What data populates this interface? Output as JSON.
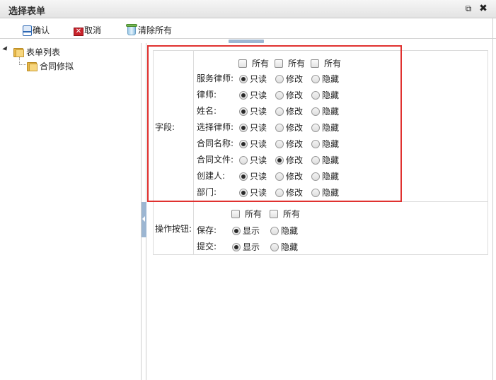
{
  "window": {
    "title": "选择表单"
  },
  "toolbar": {
    "confirm_label": "确认",
    "cancel_label": "取消",
    "clear_label": "清除所有"
  },
  "tree": {
    "root_label": "表单列表",
    "child_label": "合同修拟"
  },
  "fields": {
    "section_label": "字段:",
    "all_label": "所有",
    "opt_readonly": "只读",
    "opt_modify": "修改",
    "opt_hidden": "隐藏",
    "rows": [
      {
        "label": "服务律师:",
        "selected": "readonly"
      },
      {
        "label": "律师:",
        "selected": "readonly"
      },
      {
        "label": "姓名:",
        "selected": "readonly"
      },
      {
        "label": "选择律师:",
        "selected": "readonly"
      },
      {
        "label": "合同名称:",
        "selected": "readonly"
      },
      {
        "label": "合同文件:",
        "selected": "modify"
      },
      {
        "label": "创建人:",
        "selected": "readonly"
      },
      {
        "label": "部门:",
        "selected": "readonly"
      }
    ]
  },
  "buttons": {
    "section_label": "操作按钮:",
    "all_label": "所有",
    "opt_show": "显示",
    "opt_hidden": "隐藏",
    "rows": [
      {
        "label": "保存:",
        "selected": "show"
      },
      {
        "label": "提交:",
        "selected": "show"
      }
    ]
  },
  "colors": {
    "highlight": "#e0312f",
    "splitter": "#9cb6d2"
  }
}
